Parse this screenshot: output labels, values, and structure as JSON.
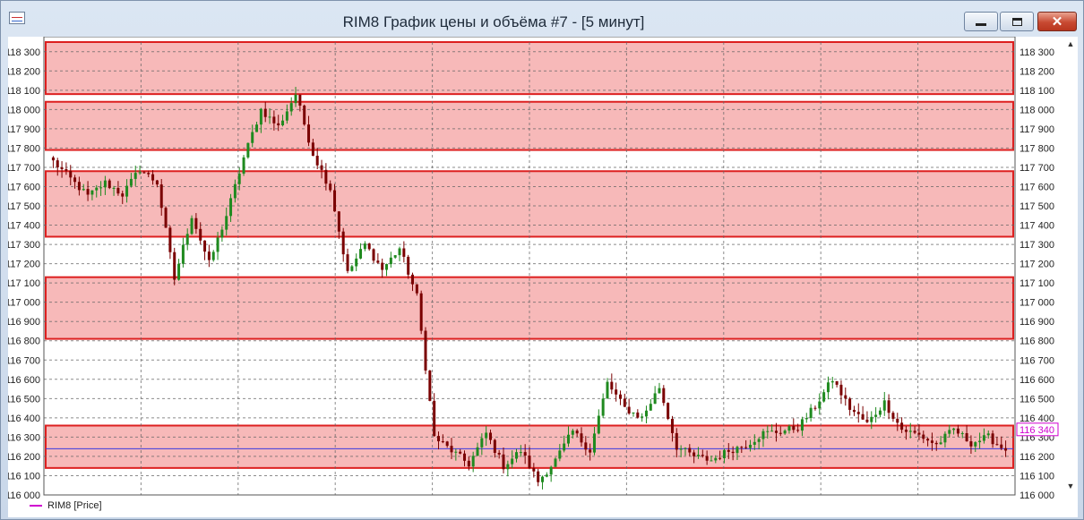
{
  "window": {
    "title": "RIM8 График цены и объёма #7 - [5 минут]",
    "min_icon": "minimize-icon",
    "max_icon": "maximize-icon",
    "close_icon": "close-icon",
    "close_glyph": "✕"
  },
  "legend": {
    "label": "RIM8 [Price]",
    "color": "#d000d0"
  },
  "current_price_label": "116 340",
  "scroll": {
    "up_glyph": "▲",
    "down_glyph": "▼"
  },
  "chart_data": {
    "type": "candlestick",
    "ylim": [
      116000,
      118350
    ],
    "yticks": [
      116000,
      116100,
      116200,
      116300,
      116400,
      116500,
      116600,
      116700,
      116800,
      116900,
      117000,
      117100,
      117200,
      117300,
      117400,
      117500,
      117600,
      117700,
      117800,
      117900,
      118000,
      118100,
      118200,
      118300
    ],
    "ytick_labels": [
      "116 000",
      "116 100",
      "116 200",
      "116 300",
      "116 400",
      "116 500",
      "116 600",
      "116 700",
      "116 800",
      "116 900",
      "117 000",
      "117 100",
      "117 200",
      "117 300",
      "117 400",
      "117 500",
      "117 600",
      "117 700",
      "117 800",
      "117 900",
      "118 000",
      "118 100",
      "118 200",
      "118 300"
    ],
    "current_price": 116340,
    "price_line": 116240,
    "zones": [
      {
        "low": 118080,
        "high": 118370
      },
      {
        "low": 117790,
        "high": 118040
      },
      {
        "low": 117340,
        "high": 117680
      },
      {
        "low": 116810,
        "high": 117130
      },
      {
        "low": 116140,
        "high": 116360
      }
    ],
    "colors": {
      "up": "#1f8a1f",
      "down": "#7a0000",
      "zone_fill": "#f7b9b9",
      "zone_border": "#dd2020",
      "price_line": "#3a3ae0",
      "grid": "#666666"
    },
    "grid": true,
    "anchors": [
      117730,
      117640,
      117550,
      117620,
      117560,
      117690,
      117620,
      117120,
      117450,
      117200,
      117450,
      117750,
      118000,
      117910,
      118080,
      117770,
      117590,
      117150,
      117300,
      117170,
      117280,
      117030,
      116300,
      116230,
      116160,
      116320,
      116150,
      116230,
      116070,
      116180,
      116330,
      116230,
      116580,
      116450,
      116400,
      116560,
      116250,
      116200,
      116180,
      116230,
      116260,
      116320,
      116330,
      116350,
      116460,
      116600,
      116450,
      116370,
      116480,
      116340,
      116310,
      116260,
      116340,
      116270,
      116300,
      116230
    ]
  }
}
